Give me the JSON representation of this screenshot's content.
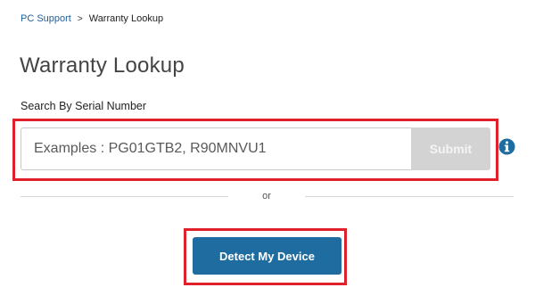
{
  "breadcrumb": {
    "root_label": "PC Support",
    "separator": ">",
    "current_label": "Warranty Lookup"
  },
  "page": {
    "title": "Warranty Lookup"
  },
  "search": {
    "label": "Search By Serial Number",
    "placeholder": "Examples : PG01GTB2, R90MNVU1",
    "value": "",
    "submit_label": "Submit",
    "submit_enabled": false,
    "info_icon": "info-circle-icon"
  },
  "divider": {
    "text": "or"
  },
  "detect": {
    "button_label": "Detect My Device"
  },
  "colors": {
    "link": "#1f5f9e",
    "primary_button": "#1f6da0",
    "disabled_button": "#d3d3d3",
    "highlight_border": "#e0202a",
    "info_icon": "#1f6da0"
  }
}
